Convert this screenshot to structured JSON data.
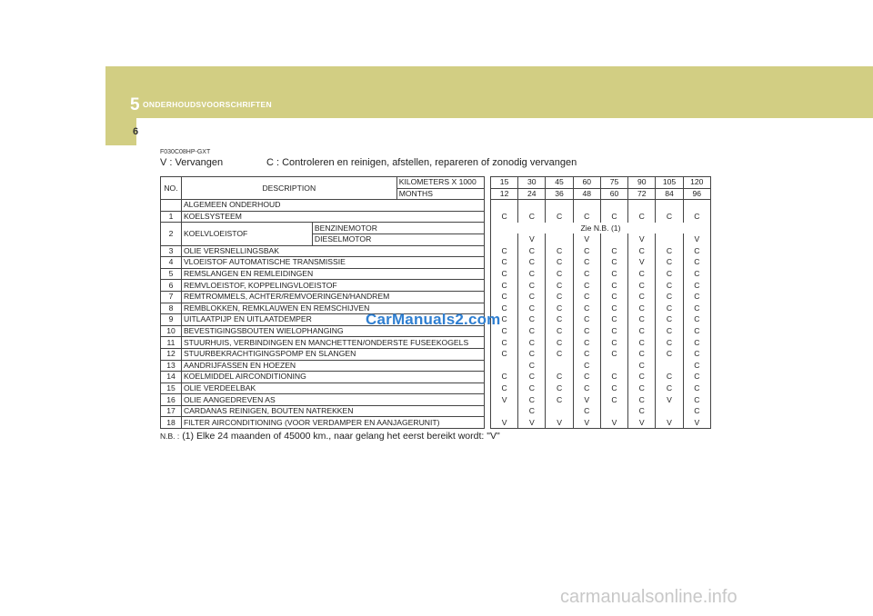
{
  "header": {
    "chapter_number": "5",
    "chapter_title": "ONDERHOUDSVOORSCHRIFTEN",
    "page_number": "6"
  },
  "code": "F030C08HP-GXT",
  "legend": {
    "v": "V : Vervangen",
    "c": "C : Controleren en reinigen, afstellen, repareren of zonodig vervangen"
  },
  "table": {
    "no_header": "NO.",
    "desc_header": "DESCRIPTION",
    "km_label": "KILOMETERS X 1000",
    "months_label": "MONTHS",
    "km": [
      "15",
      "30",
      "45",
      "60",
      "75",
      "90",
      "105",
      "120"
    ],
    "months": [
      "12",
      "24",
      "36",
      "48",
      "60",
      "72",
      "84",
      "96"
    ],
    "general_label": "ALGEMEEN ONDERHOUD",
    "rows": [
      {
        "no": "1",
        "desc": "KOELSYSTEEM",
        "v": [
          "C",
          "C",
          "C",
          "C",
          "C",
          "C",
          "C",
          "C"
        ]
      },
      {
        "no": "3",
        "desc": "OLIE VERSNELLINGSBAK",
        "v": [
          "C",
          "C",
          "C",
          "C",
          "C",
          "C",
          "C",
          "C"
        ]
      },
      {
        "no": "4",
        "desc": "VLOEISTOF AUTOMATISCHE TRANSMISSIE",
        "v": [
          "C",
          "C",
          "C",
          "C",
          "C",
          "V",
          "C",
          "C"
        ]
      },
      {
        "no": "5",
        "desc": "REMSLANGEN EN REMLEIDINGEN",
        "v": [
          "C",
          "C",
          "C",
          "C",
          "C",
          "C",
          "C",
          "C"
        ]
      },
      {
        "no": "6",
        "desc": "REMVLOEISTOF, KOPPELINGVLOEISTOF",
        "v": [
          "C",
          "C",
          "C",
          "C",
          "C",
          "C",
          "C",
          "C"
        ]
      },
      {
        "no": "7",
        "desc": "REMTROMMELS, ACHTER/REMVOERINGEN/HANDREM",
        "v": [
          "C",
          "C",
          "C",
          "C",
          "C",
          "C",
          "C",
          "C"
        ]
      },
      {
        "no": "8",
        "desc": "REMBLOKKEN, REMKLAUWEN EN REMSCHIJVEN",
        "v": [
          "C",
          "C",
          "C",
          "C",
          "C",
          "C",
          "C",
          "C"
        ]
      },
      {
        "no": "9",
        "desc": "UITLAATPIJP EN UITLAATDEMPER",
        "v": [
          "C",
          "C",
          "C",
          "C",
          "C",
          "C",
          "C",
          "C"
        ]
      },
      {
        "no": "10",
        "desc": "BEVESTIGINGSBOUTEN WIELOPHANGING",
        "v": [
          "C",
          "C",
          "C",
          "C",
          "C",
          "C",
          "C",
          "C"
        ]
      },
      {
        "no": "11",
        "desc": "STUURHUIS, VERBINDINGEN EN MANCHETTEN/ONDERSTE FUSEEKOGELS",
        "v": [
          "C",
          "C",
          "C",
          "C",
          "C",
          "C",
          "C",
          "C"
        ]
      },
      {
        "no": "12",
        "desc": "STUURBEKRACHTIGINGSPOMP EN SLANGEN",
        "v": [
          "C",
          "C",
          "C",
          "C",
          "C",
          "C",
          "C",
          "C"
        ]
      },
      {
        "no": "13",
        "desc": "AANDRIJFASSEN EN HOEZEN",
        "v": [
          "",
          "C",
          "",
          "C",
          "",
          "C",
          "",
          "C"
        ]
      },
      {
        "no": "14",
        "desc": "KOELMIDDEL AIRCONDITIONING",
        "v": [
          "C",
          "C",
          "C",
          "C",
          "C",
          "C",
          "C",
          "C"
        ]
      },
      {
        "no": "15",
        "desc": "OLIE VERDEELBAK",
        "v": [
          "C",
          "C",
          "C",
          "C",
          "C",
          "C",
          "C",
          "C"
        ]
      },
      {
        "no": "16",
        "desc": "OLIE AANGEDREVEN AS",
        "v": [
          "V",
          "C",
          "C",
          "V",
          "C",
          "C",
          "V",
          "C"
        ]
      },
      {
        "no": "17",
        "desc": "CARDANAS REINIGEN, BOUTEN NATREKKEN",
        "v": [
          "",
          "C",
          "",
          "C",
          "",
          "C",
          "",
          "C"
        ]
      },
      {
        "no": "18",
        "desc": "FILTER AIRCONDITIONING (VOOR VERDAMPER EN AANJAGERUNIT)",
        "v": [
          "V",
          "V",
          "V",
          "V",
          "V",
          "V",
          "V",
          "V"
        ]
      }
    ],
    "row2": {
      "no": "2",
      "desc": "KOELVLOEISTOF",
      "benzine": "BENZINEMOTOR",
      "diesel": "DIESELMOTOR",
      "benzine_note": "Zie N.B. (1)",
      "diesel_v": [
        "",
        "V",
        "",
        "V",
        "",
        "V",
        "",
        "V"
      ]
    }
  },
  "footnote": {
    "label": "N.B. :",
    "text": "(1) Elke 24 maanden of 45000 km., naar gelang het eerst bereikt wordt: \"V\""
  },
  "watermarks": {
    "middle": "CarManuals2.com",
    "bottom": "carmanualsonline.info"
  },
  "colors": {
    "band": "#d2ce83",
    "watermark_blue": "#2f7fd1"
  }
}
